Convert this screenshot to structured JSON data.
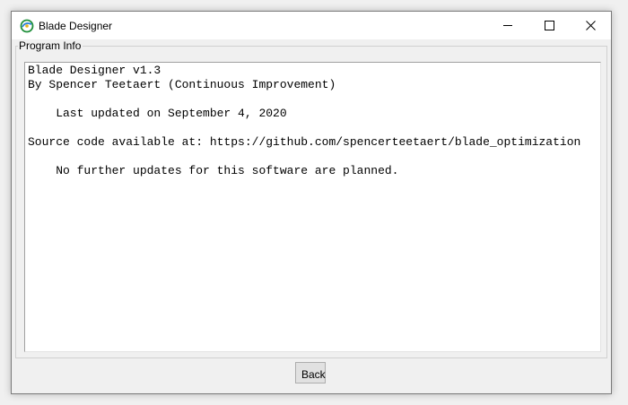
{
  "window": {
    "title": "Blade Designer",
    "icon": "circle-swirl-icon",
    "controls": {
      "minimize": "minimize-icon",
      "maximize": "maximize-icon",
      "close": "close-icon"
    }
  },
  "group": {
    "label": "Program Info",
    "lines": [
      "Blade Designer v1.3",
      "By Spencer Teetaert (Continuous Improvement)",
      "",
      "    Last updated on September 4, 2020",
      "",
      "Source code available at: https://github.com/spencerteetaert/blade_optimization",
      "",
      "    No further updates for this software are planned."
    ]
  },
  "actions": {
    "back_label": "Back"
  }
}
